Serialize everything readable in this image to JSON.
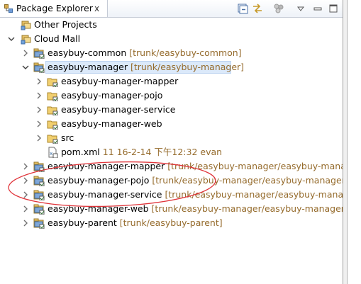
{
  "tab": {
    "title": "Package Explorer",
    "close_glyph": "ⅹ"
  },
  "tree": {
    "other_projects": "Other Projects",
    "cloud_mall": "Cloud Mall",
    "easybuy_common": {
      "label": "easybuy-common",
      "decoration": "[trunk/easybuy-common]"
    },
    "easybuy_manager": {
      "label": "easybuy-manager",
      "decoration": "[trunk/easybuy-manager]"
    },
    "modules": [
      "easybuy-manager-mapper",
      "easybuy-manager-pojo",
      "easybuy-manager-service",
      "easybuy-manager-web",
      "src"
    ],
    "pom": {
      "label": "pom.xml",
      "decoration": "11  16-2-14 下午12:32  evan"
    },
    "projects": [
      {
        "label": "easybuy-manager-mapper",
        "decoration": "[trunk/easybuy-manager/easybuy-manager-"
      },
      {
        "label": "easybuy-manager-pojo",
        "decoration": "[trunk/easybuy-manager/easybuy-manager-po"
      },
      {
        "label": "easybuy-manager-service",
        "decoration": "[trunk/easybuy-manager/easybuy-manager-s"
      },
      {
        "label": "easybuy-manager-web",
        "decoration": "[trunk/easybuy-manager/easybuy-manager-web"
      },
      {
        "label": "easybuy-parent",
        "decoration": "[trunk/easybuy-parent]"
      }
    ]
  },
  "colors": {
    "decoration": "#956b2c",
    "selection": "#dbe9fa",
    "annotation": "#e0343a"
  }
}
